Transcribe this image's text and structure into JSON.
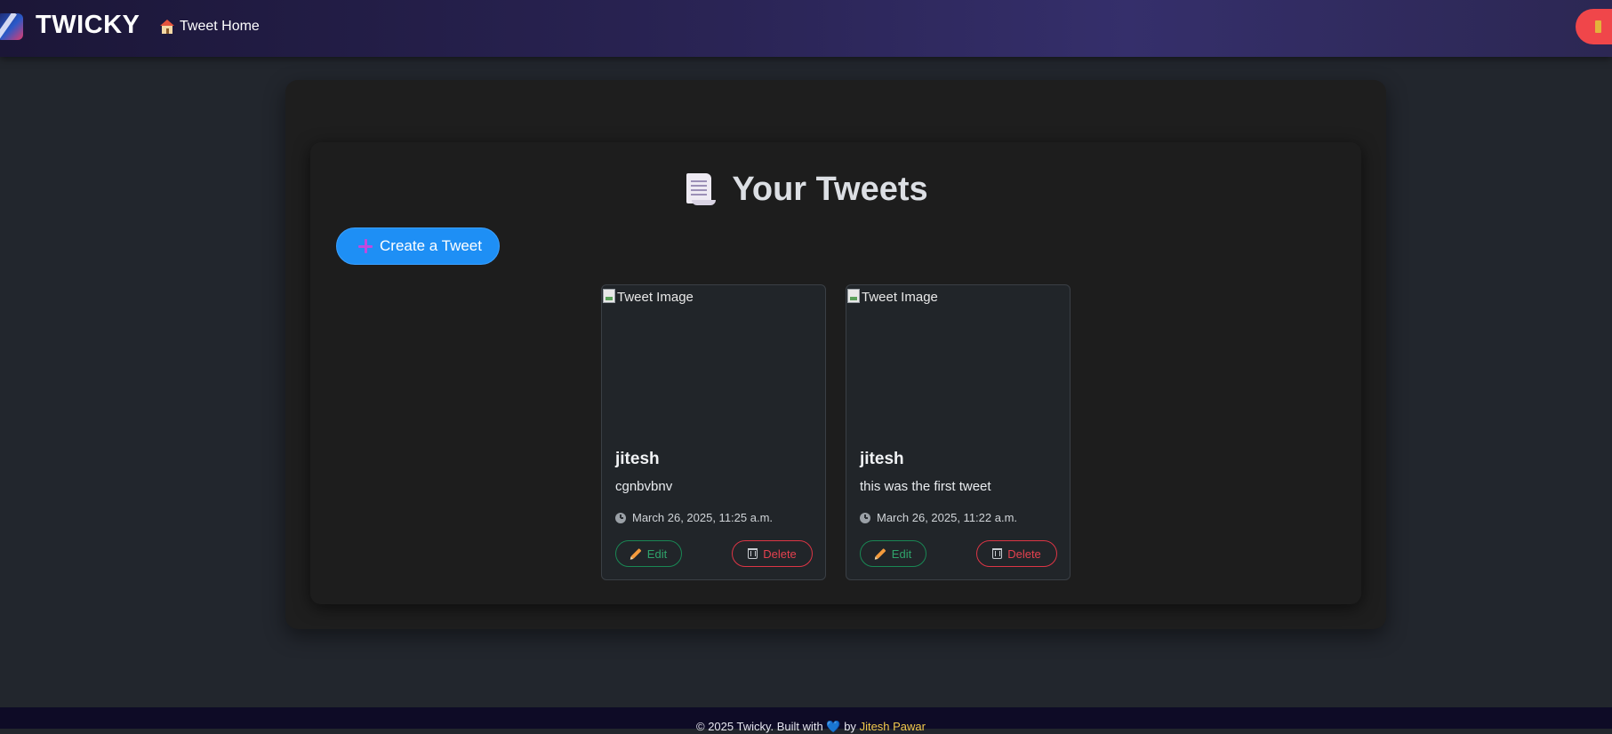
{
  "navbar": {
    "brand": "TWICKY",
    "home_link": "Tweet Home",
    "home_icon": "house-icon",
    "logout_icon": "door-icon",
    "logout_color": "#f0464a"
  },
  "main": {
    "title": "Your Tweets",
    "title_icon": "scroll-icon",
    "create_button": "Create a Tweet",
    "tweets": [
      {
        "image_alt": "Tweet Image",
        "author": "jitesh",
        "text": "cgnbvbnv",
        "timestamp": "March 26, 2025, 11:25 a.m.",
        "edit_label": "Edit",
        "delete_label": "Delete"
      },
      {
        "image_alt": "Tweet Image",
        "author": "jitesh",
        "text": "this was the first tweet",
        "timestamp": "March 26, 2025, 11:22 a.m.",
        "edit_label": "Edit",
        "delete_label": "Delete"
      }
    ]
  },
  "footer": {
    "text_before": "© 2025 Twicky. Built with",
    "heart": "💙",
    "text_by": "by",
    "author": "Jitesh Pawar"
  },
  "colors": {
    "accent": "#1e8ff5",
    "edit": "#198754",
    "delete": "#dc3545"
  }
}
